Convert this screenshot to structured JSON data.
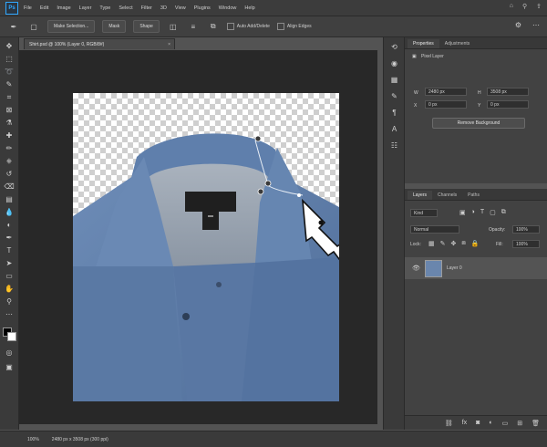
{
  "menubar": {
    "logo": "Ps",
    "items": [
      "File",
      "Edit",
      "Image",
      "Layer",
      "Type",
      "Select",
      "Filter",
      "3D",
      "View",
      "Plugins",
      "Window",
      "Help"
    ],
    "right_icons": [
      "home-icon",
      "search-icon",
      "share-icon"
    ]
  },
  "options": {
    "make_selection": "Make Selection...",
    "mask": "Mask",
    "shape": "Shape",
    "auto_add_delete": "Auto Add/Delete",
    "align_edges": "Align Edges",
    "right_icons": [
      "gear-icon",
      "more-icon"
    ]
  },
  "document": {
    "tab_label": "Shirt.psd @ 100% (Layer 0, RGB/8#)",
    "close": "×"
  },
  "properties": {
    "tabs": [
      "Properties",
      "Adjustments"
    ],
    "header": "Pixel Layer",
    "w_label": "W",
    "w_value": "2480 px",
    "h_label": "H",
    "h_value": "3508 px",
    "x_label": "X",
    "x_value": "0 px",
    "y_label": "Y",
    "y_value": "0 px",
    "remove_bg_button": "Remove Background"
  },
  "layers": {
    "tabs": [
      "Layers",
      "Channels",
      "Paths"
    ],
    "kind_filter": "Kind",
    "blend_mode": "Normal",
    "opacity_label": "Opacity:",
    "opacity_value": "100%",
    "lock_label": "Lock:",
    "fill_label": "Fill:",
    "fill_value": "100%",
    "layer_name": "Layer 0"
  },
  "status": {
    "zoom": "100%",
    "info": "2480 px x 3508 px (300 ppi)"
  },
  "colors": {
    "shirt": "#5b7ba6",
    "collar_inner": "#9aa5b1",
    "label": "#1f1f1f",
    "accent": "#31a8ff"
  }
}
